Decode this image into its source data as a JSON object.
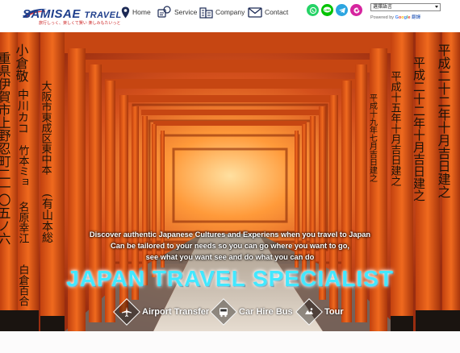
{
  "brand": {
    "name": "SAMISAE",
    "suffix": "TRAVEL",
    "tagline": "旅行しっく、楽しくて賢い 楽しみもたいっと"
  },
  "nav": [
    {
      "label": "Home",
      "icon": "map-pin-icon"
    },
    {
      "label": "Service",
      "icon": "service-icon"
    },
    {
      "label": "Company",
      "icon": "company-icon"
    },
    {
      "label": "Contact",
      "icon": "mail-icon"
    }
  ],
  "social": [
    {
      "name": "whatsapp-icon",
      "color": "#25d366"
    },
    {
      "name": "line-icon",
      "color": "#00c300"
    },
    {
      "name": "telegram-icon",
      "color": "#2ca5e0"
    },
    {
      "name": "instagram-icon",
      "color": "#d6249f"
    }
  ],
  "translate": {
    "selected": "選擇語言",
    "powered_by": "Powered by",
    "google": "Google",
    "translate_label": "翻譯"
  },
  "hero": {
    "line1": "Discover authentic Japanese Cultures and Experiens when you travel to Japan",
    "line2": "Can be tailored to your needs so you can go where you want to go,",
    "line3": "see what you want see and do what you can do",
    "title": "JAPAN TRAVEL SPECIALIST",
    "left_pillars": [
      "小倉敬",
      "中川カコ",
      "竹本ミョ",
      "名原幸江",
      "白倉百合"
    ],
    "left_pillars2": [
      "重県伊賀市上野忍町二一〇五ノ六",
      "大阪市東成区東中本",
      "(有山本総",
      "大阪"
    ],
    "right_pillars": [
      "平成二十二年十月吉日建之",
      "平成十五年十月吉日建之",
      "平成十九年七月吉日建之"
    ]
  },
  "services": [
    {
      "label": "Airport Transfer",
      "icon": "airplane-icon"
    },
    {
      "label": "Car Hire Bus",
      "icon": "bus-icon"
    },
    {
      "label": "Tour",
      "icon": "tour-icon"
    }
  ]
}
